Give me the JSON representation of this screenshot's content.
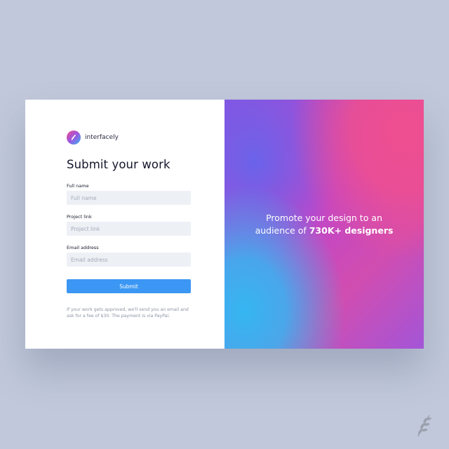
{
  "brand": {
    "name": "interfacely"
  },
  "form": {
    "title": "Submit your work",
    "fields": [
      {
        "label": "Full name",
        "placeholder": "Full name"
      },
      {
        "label": "Project link",
        "placeholder": "Project link"
      },
      {
        "label": "Email address",
        "placeholder": "Email address"
      }
    ],
    "submit_label": "Submit",
    "note": "If your work gets approved, we'll send you an email and ask for a fee of $30. The payment is via PayPal."
  },
  "promo": {
    "line1": "Promote your design to an",
    "line2_prefix": "audience of ",
    "line2_bold": "730K+ designers"
  },
  "colors": {
    "background": "#c1c8db",
    "accent": "#3b97f3",
    "gradient_pink": "#ef4f8f",
    "gradient_blue": "#35b6f2",
    "gradient_purple": "#8a52e0"
  },
  "icons": {
    "logo": "laurel-leaf-icon",
    "corner": "laurel-leaf-icon"
  }
}
